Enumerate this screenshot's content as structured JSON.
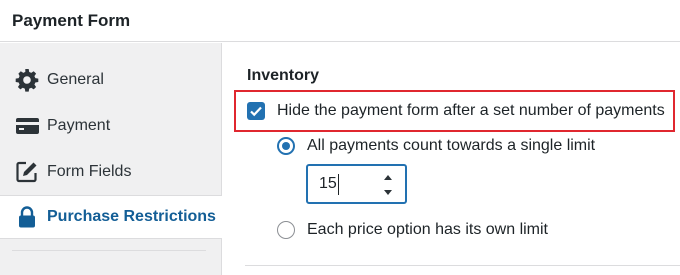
{
  "header": {
    "title": "Payment Form"
  },
  "sidebar": {
    "items": [
      {
        "label": "General",
        "icon": "gear-icon",
        "active": false
      },
      {
        "label": "Payment",
        "icon": "credit-card-icon",
        "active": false
      },
      {
        "label": "Form Fields",
        "icon": "edit-icon",
        "active": false
      },
      {
        "label": "Purchase Restrictions",
        "icon": "lock-icon",
        "active": true
      }
    ]
  },
  "main": {
    "section_title": "Inventory",
    "hide_form_checkbox": {
      "label": "Hide the payment form after a set number of payments",
      "checked": true
    },
    "limit_options": [
      {
        "label": "All payments count towards a single limit",
        "selected": true
      },
      {
        "label": "Each price option has its own limit",
        "selected": false
      }
    ],
    "limit_input": {
      "value": "15"
    }
  },
  "colors": {
    "accent": "#2271b1",
    "active_nav_text": "#135e96",
    "highlight_border": "#e0272f",
    "sidebar_bg": "#f0f0f1"
  }
}
